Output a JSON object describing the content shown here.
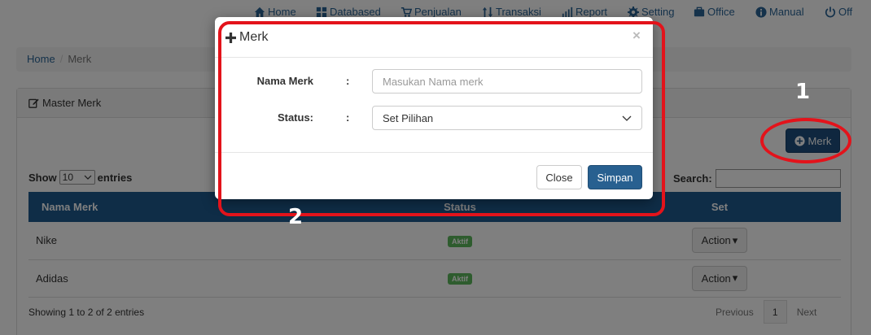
{
  "topnav": {
    "items": [
      {
        "label": "Home",
        "icon": "home-icon"
      },
      {
        "label": "Databased",
        "icon": "grid-icon"
      },
      {
        "label": "Penjualan",
        "icon": "cart-icon"
      },
      {
        "label": "Transaksi",
        "icon": "sort-arrows-icon"
      },
      {
        "label": "Report",
        "icon": "bar-chart-icon"
      },
      {
        "label": "Setting",
        "icon": "gear-icon"
      },
      {
        "label": "Office",
        "icon": "briefcase-icon"
      },
      {
        "label": "Manual",
        "icon": "info-icon"
      },
      {
        "label": "Off",
        "icon": "power-icon"
      }
    ]
  },
  "breadcrumb": {
    "home": "Home",
    "separator": "/",
    "current": "Merk"
  },
  "panel": {
    "title": "Master Merk",
    "add_button": "Merk",
    "show_label": "Show",
    "entries_value": "10",
    "entries_label": "entries",
    "search_label": "Search:",
    "columns": [
      "Nama Merk",
      "Status",
      "Set"
    ],
    "rows": [
      {
        "name": "Nike",
        "status": "Aktif",
        "action": "Action"
      },
      {
        "name": "Adidas",
        "status": "Aktif",
        "action": "Action"
      }
    ],
    "info": "Showing 1 to 2 of 2 entries",
    "pagination": {
      "prev": "Previous",
      "page": "1",
      "next": "Next"
    }
  },
  "modal": {
    "title": "Merk",
    "close_symbol": "×",
    "name_label": "Nama Merk",
    "name_placeholder": "Masukan Nama merk",
    "status_label": "Status:",
    "colon": ":",
    "status_value": "Set Pilihan",
    "close_button": "Close",
    "save_button": "Simpan"
  },
  "annotations": {
    "label_1": "1",
    "label_2": "2",
    "color": "#e3131b"
  },
  "colors": {
    "primary": "#286090",
    "header_blue": "#1e5a8e",
    "badge_green": "#5cb85c"
  }
}
